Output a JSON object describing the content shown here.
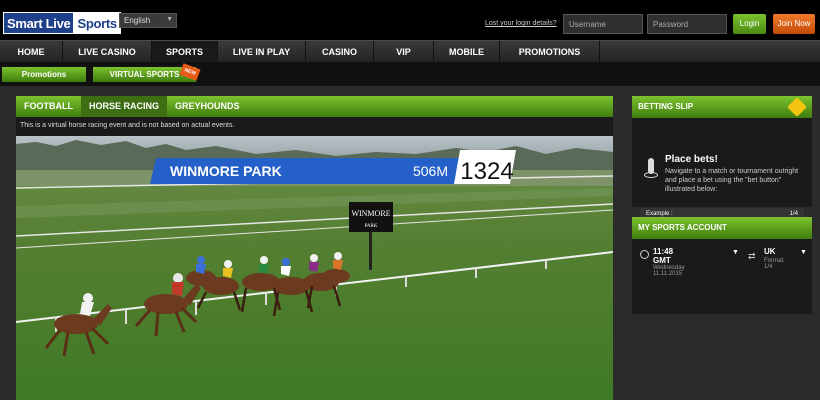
{
  "header": {
    "logo_left": "Smart Live",
    "logo_right": "Sports",
    "language": "English",
    "lost_login": "Lost your login details?",
    "username_placeholder": "Username",
    "password_placeholder": "Password",
    "login_label": "Login",
    "join_label": "Join Now"
  },
  "nav": {
    "items": [
      "HOME",
      "LIVE CASINO",
      "SPORTS",
      "LIVE IN PLAY",
      "CASINO",
      "VIP",
      "MOBILE",
      "PROMOTIONS"
    ],
    "active": "SPORTS"
  },
  "subnav": {
    "promotions": "Promotions",
    "virtual_sports": "VIRTUAL SPORTS",
    "ribbon": "NEW"
  },
  "sports_tabs": {
    "items": [
      "FOOTBALL",
      "HORSE RACING",
      "GREYHOUNDS"
    ],
    "active": "HORSE RACING"
  },
  "notice": "This is a virtual horse racing event and is not based on actual events.",
  "race": {
    "track": "WINMORE PARK",
    "distance": "506M",
    "counter": "1324",
    "sign_top": "WINMORE",
    "sign_bottom": "PARK"
  },
  "betting_slip": {
    "title": "BETTING SLIP",
    "place_bets": "Place bets!",
    "instructions": "Navigate to a match or tournament outright and place a bet using the \"bet button\" illustrated below:",
    "example_label": "Example :",
    "example_value": "1/4"
  },
  "account": {
    "title": "MY SPORTS ACCOUNT",
    "time": "11:48",
    "timezone": "GMT",
    "day": "Wednesday",
    "date": "11.11.2015",
    "region": "UK",
    "format_label": "Format:",
    "format_value": "1/4"
  },
  "colors": {
    "green_accent": "#6fb52a",
    "orange_accent": "#e8661a",
    "race_banner": "#2460c8"
  }
}
